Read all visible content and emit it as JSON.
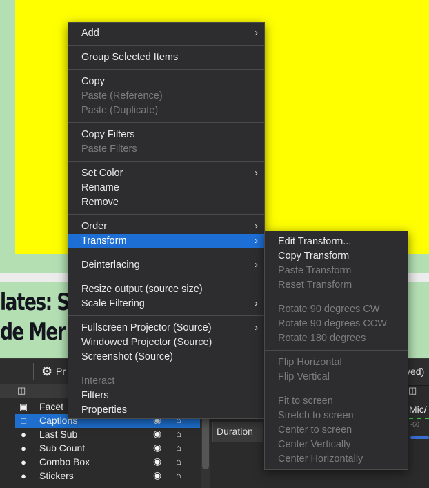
{
  "preview": {
    "headline_line1": "lates: S",
    "headline_line2": "de Mer"
  },
  "dock": {
    "title": "Pr",
    "saved_fragment": "ved)",
    "duration_label": "Duration",
    "mixer_label": "Mic/",
    "mixer_db": "-60"
  },
  "sources": [
    {
      "name": "Facet",
      "icon": "camera-icon",
      "glyph": "▣",
      "selected": false,
      "locked": false
    },
    {
      "name": "Captions",
      "icon": "window-icon",
      "glyph": "□",
      "selected": true,
      "locked": false
    },
    {
      "name": "Last Sub",
      "icon": "globe-icon",
      "glyph": "●",
      "selected": false,
      "locked": false
    },
    {
      "name": "Sub Count",
      "icon": "globe-icon",
      "glyph": "●",
      "selected": false,
      "locked": false
    },
    {
      "name": "Combo Box",
      "icon": "globe-icon",
      "glyph": "●",
      "selected": false,
      "locked": false
    },
    {
      "name": "Stickers",
      "icon": "globe-icon",
      "glyph": "●",
      "selected": false,
      "locked": true
    }
  ],
  "context_menu": {
    "groups": [
      [
        {
          "label": "Add",
          "submenu": true,
          "disabled": false
        }
      ],
      [
        {
          "label": "Group Selected Items",
          "submenu": false,
          "disabled": false
        }
      ],
      [
        {
          "label": "Copy",
          "submenu": false,
          "disabled": false
        },
        {
          "label": "Paste (Reference)",
          "submenu": false,
          "disabled": true
        },
        {
          "label": "Paste (Duplicate)",
          "submenu": false,
          "disabled": true
        }
      ],
      [
        {
          "label": "Copy Filters",
          "submenu": false,
          "disabled": false
        },
        {
          "label": "Paste Filters",
          "submenu": false,
          "disabled": true
        }
      ],
      [
        {
          "label": "Set Color",
          "submenu": true,
          "disabled": false
        },
        {
          "label": "Rename",
          "submenu": false,
          "disabled": false
        },
        {
          "label": "Remove",
          "submenu": false,
          "disabled": false
        }
      ],
      [
        {
          "label": "Order",
          "submenu": true,
          "disabled": false
        },
        {
          "label": "Transform",
          "submenu": true,
          "disabled": false,
          "active": true
        }
      ],
      [
        {
          "label": "Deinterlacing",
          "submenu": true,
          "disabled": false
        }
      ],
      [
        {
          "label": "Resize output (source size)",
          "submenu": false,
          "disabled": false
        },
        {
          "label": "Scale Filtering",
          "submenu": true,
          "disabled": false
        }
      ],
      [
        {
          "label": "Fullscreen Projector (Source)",
          "submenu": true,
          "disabled": false
        },
        {
          "label": "Windowed Projector (Source)",
          "submenu": false,
          "disabled": false
        },
        {
          "label": "Screenshot (Source)",
          "submenu": false,
          "disabled": false
        }
      ],
      [
        {
          "label": "Interact",
          "submenu": false,
          "disabled": true
        },
        {
          "label": "Filters",
          "submenu": false,
          "disabled": false
        },
        {
          "label": "Properties",
          "submenu": false,
          "disabled": false
        }
      ]
    ]
  },
  "transform_submenu": {
    "groups": [
      [
        {
          "label": "Edit Transform...",
          "disabled": false
        },
        {
          "label": "Copy Transform",
          "disabled": false
        },
        {
          "label": "Paste Transform",
          "disabled": true
        },
        {
          "label": "Reset Transform",
          "disabled": true
        }
      ],
      [
        {
          "label": "Rotate 90 degrees CW",
          "disabled": true
        },
        {
          "label": "Rotate 90 degrees CCW",
          "disabled": true
        },
        {
          "label": "Rotate 180 degrees",
          "disabled": true
        }
      ],
      [
        {
          "label": "Flip Horizontal",
          "disabled": true
        },
        {
          "label": "Flip Vertical",
          "disabled": true
        }
      ],
      [
        {
          "label": "Fit to screen",
          "disabled": true
        },
        {
          "label": "Stretch to screen",
          "disabled": true
        },
        {
          "label": "Center to screen",
          "disabled": true
        },
        {
          "label": "Center Vertically",
          "disabled": true
        },
        {
          "label": "Center Horizontally",
          "disabled": true
        }
      ]
    ]
  },
  "colors": {
    "preview_yellow": "#ffff00",
    "preview_green": "#b3dfb3",
    "highlight_blue": "#1d6fd6",
    "menu_bg": "#2d2d2f"
  }
}
